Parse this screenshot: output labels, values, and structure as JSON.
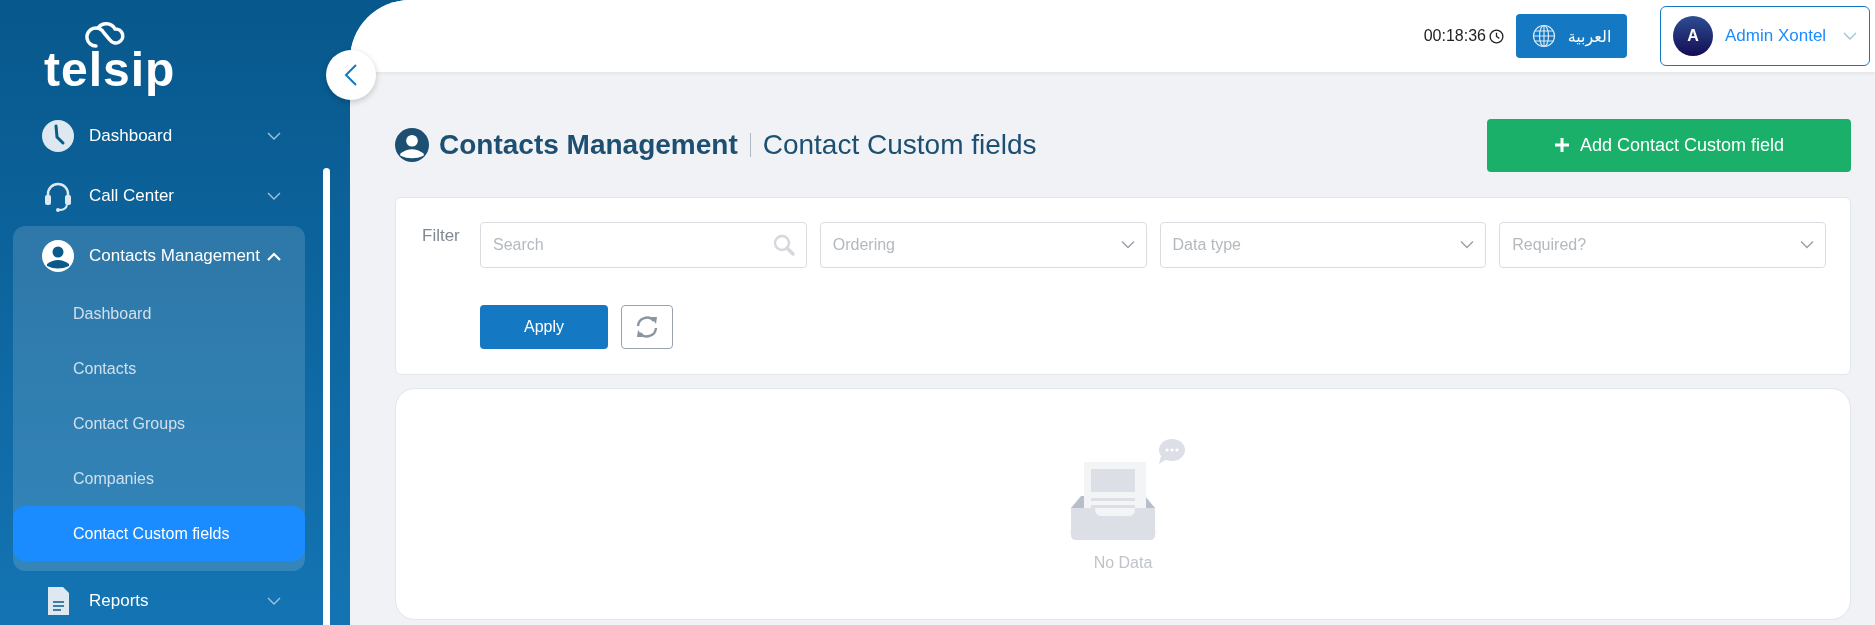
{
  "logo": {
    "text": "telsip"
  },
  "nav": [
    {
      "kind": "clock",
      "label": "Dashboard",
      "expanded": false
    },
    {
      "kind": "headset",
      "label": "Call Center",
      "expanded": false
    },
    {
      "kind": "user",
      "label": "Contacts Management",
      "expanded": true,
      "children": [
        {
          "label": "Dashboard",
          "selected": false
        },
        {
          "label": "Contacts",
          "selected": false
        },
        {
          "label": "Contact Groups",
          "selected": false
        },
        {
          "label": "Companies",
          "selected": false
        },
        {
          "label": "Contact Custom fields",
          "selected": true
        }
      ]
    },
    {
      "kind": "document",
      "label": "Reports",
      "expanded": false
    }
  ],
  "header": {
    "time": "00:18:36",
    "language_button": "العربية",
    "user": {
      "initial": "A",
      "name": "Admin Xontel"
    }
  },
  "page_title": {
    "section": "Contacts Management",
    "subtitle": "Contact Custom fields"
  },
  "add_button": "Add Contact Custom field",
  "filter": {
    "label": "Filter",
    "fields": [
      {
        "kind": "search",
        "placeholder": "Search"
      },
      {
        "kind": "select",
        "placeholder": "Ordering"
      },
      {
        "kind": "select",
        "placeholder": "Data type"
      },
      {
        "kind": "select",
        "placeholder": "Required?"
      }
    ],
    "apply_button": "Apply"
  },
  "empty_state": {
    "text": "No Data"
  }
}
